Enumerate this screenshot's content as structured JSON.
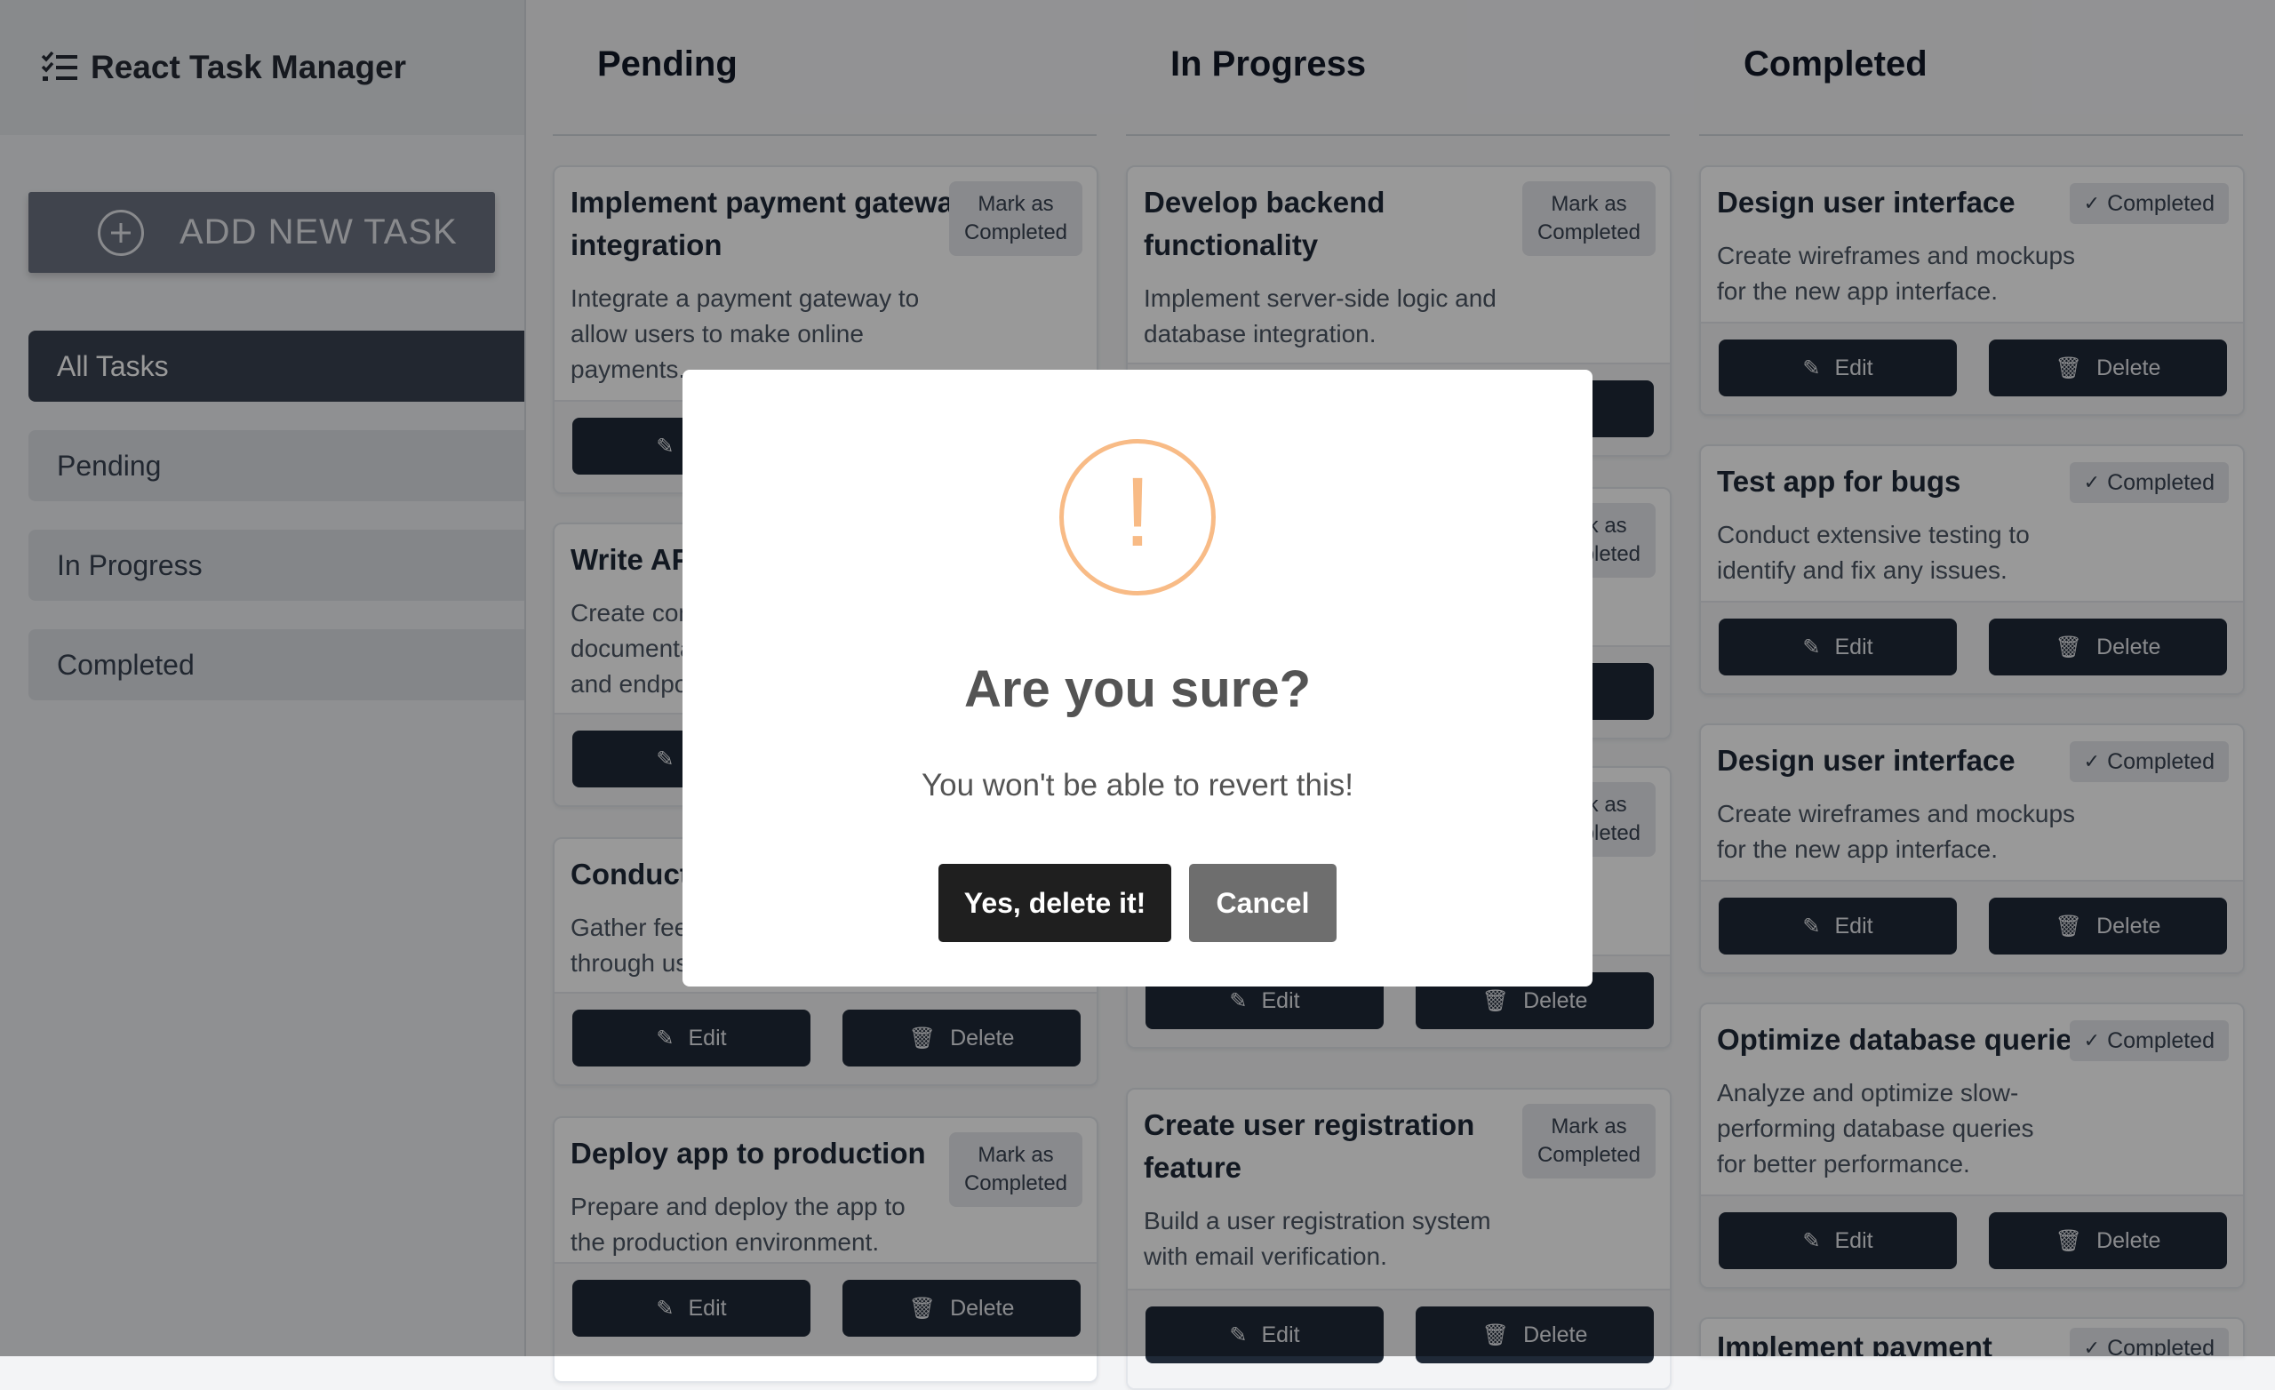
{
  "app": {
    "title": "React Task Manager",
    "brand_icon": "task-list-icon"
  },
  "sidebar": {
    "add_button": "ADD NEW TASK",
    "items": [
      {
        "label": "All Tasks",
        "active": true
      },
      {
        "label": "Pending",
        "active": false
      },
      {
        "label": "In Progress",
        "active": false
      },
      {
        "label": "Completed",
        "active": false
      }
    ]
  },
  "columns": [
    {
      "title": "Pending"
    },
    {
      "title": "In Progress"
    },
    {
      "title": "Completed"
    }
  ],
  "labels": {
    "mark_line1": "Mark as",
    "mark_line2": "Completed",
    "completed": "Completed",
    "edit": "Edit",
    "delete": "Delete"
  },
  "pending_tasks": [
    {
      "title_l1": "Implement payment gateway",
      "title_l2": "integration",
      "desc": [
        "Integrate a payment gateway to",
        "allow users to make online",
        "payments."
      ]
    },
    {
      "title_l1": "Write API documentation",
      "desc": [
        "Create comprehensive",
        "documentation for all APIs",
        "and endpoints."
      ]
    },
    {
      "title_l1": "Conduct user testing",
      "desc": [
        "Gather feedback on the app",
        "through user testing sessions."
      ]
    },
    {
      "title_l1": "Deploy app to production",
      "desc": [
        "Prepare and deploy the app to",
        "the production environment."
      ]
    }
  ],
  "progress_tasks": [
    {
      "title_l1": "Develop backend",
      "title_l2": "functionality",
      "desc": [
        "Implement server-side logic and",
        "database integration."
      ]
    },
    {
      "title_l1": "Create user registration",
      "title_l2": "feature",
      "desc": [
        "Build a user registration system",
        "with email verification."
      ]
    }
  ],
  "completed_tasks": [
    {
      "title_l1": "Design user interface",
      "desc": [
        "Create wireframes and mockups",
        "for the new app interface."
      ]
    },
    {
      "title_l1": "Test app for bugs",
      "desc": [
        "Conduct extensive testing to",
        "identify and fix any issues."
      ]
    },
    {
      "title_l1": "Design user interface",
      "desc": [
        "Create wireframes and mockups",
        "for the new app interface."
      ]
    },
    {
      "title_l1": "Optimize database queries",
      "desc": [
        "Analyze and optimize slow-",
        "performing database queries",
        "for better performance."
      ]
    },
    {
      "title_l1": "Implement payment"
    }
  ],
  "modal": {
    "icon": "warning-icon",
    "icon_glyph": "!",
    "title": "Are you sure?",
    "text": "You won't be able to revert this!",
    "confirm": "Yes, delete it!",
    "cancel": "Cancel"
  },
  "colors": {
    "overlay": "#00000066",
    "warning": "#f8bb86",
    "primary": "#1f2937"
  }
}
